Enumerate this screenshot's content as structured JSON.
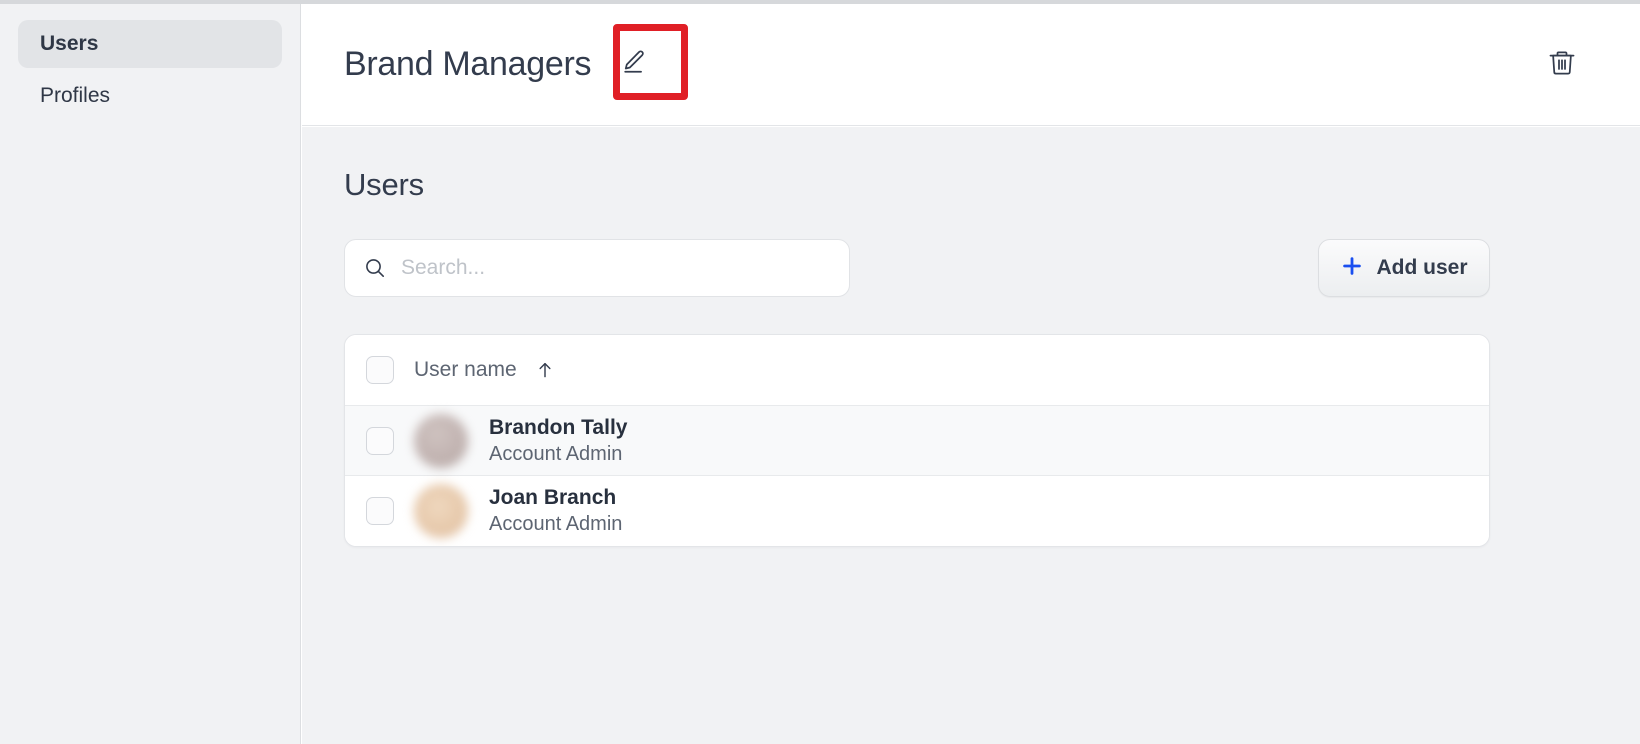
{
  "window": {
    "top_strip_color": "#d6d8db"
  },
  "sidebar": {
    "items": [
      {
        "label": "Users",
        "state": "active"
      },
      {
        "label": "Profiles",
        "state": "inactive"
      }
    ]
  },
  "header": {
    "title": "Brand Managers",
    "edit_icon": "pencil-edit-icon",
    "delete_icon": "trash-icon"
  },
  "annotation": {
    "target": "edit-brand-managers-button",
    "color": "#e01f26"
  },
  "main": {
    "section_title": "Users",
    "search": {
      "icon": "search-icon",
      "value": "",
      "placeholder": "Search..."
    },
    "add_user_button": {
      "label": "Add user",
      "icon": "plus-icon",
      "icon_color": "#1a4ff0"
    },
    "table": {
      "columns": [
        {
          "key": "select",
          "label": ""
        },
        {
          "key": "user_name",
          "label": "User name",
          "sort": "ascending",
          "sort_icon": "arrow-up-icon"
        }
      ],
      "rows": [
        {
          "selected": false,
          "avatar": "avatar-brandon-tally",
          "name": "Brandon Tally",
          "role": "Account Admin",
          "hovered": true
        },
        {
          "selected": false,
          "avatar": "avatar-joan-branch",
          "name": "Joan Branch",
          "role": "Account Admin",
          "hovered": false
        }
      ]
    }
  },
  "colors": {
    "accent_blue": "#1a4ff0",
    "annotation_red": "#e01f26",
    "page_bg": "#f1f2f4",
    "card_bg": "#ffffff",
    "text_primary": "#333c4d",
    "text_secondary": "#5d6572"
  }
}
